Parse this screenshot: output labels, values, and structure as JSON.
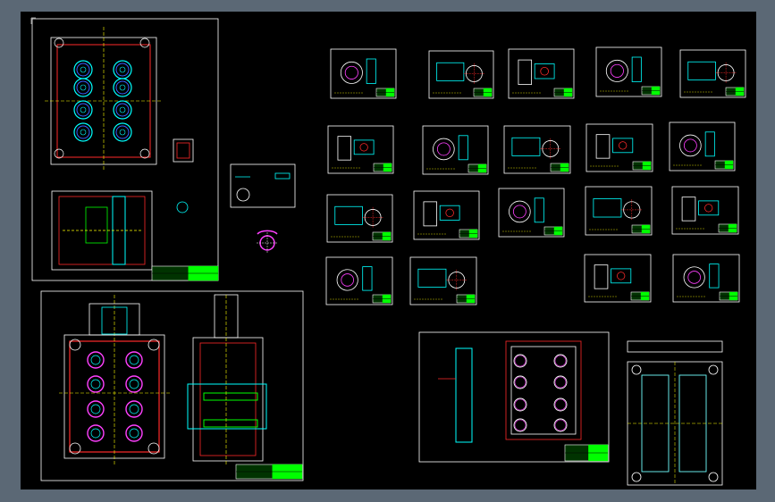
{
  "app": {
    "viewport_background": "#000000",
    "frame_background": "#5b6875"
  },
  "drawing": {
    "ucs_marker": "F",
    "colors": {
      "outline": "#ffffff",
      "mold_red": "#ff2a2a",
      "cyan": "#00ffff",
      "magenta": "#ff40ff",
      "green": "#00ff00",
      "yellow": "#ffff00",
      "blue": "#3a60ff"
    },
    "title_block_icon": "title-block",
    "sheet_icon": "part-drawing-sheet",
    "assembly_icon": "mold-assembly-drawing"
  }
}
